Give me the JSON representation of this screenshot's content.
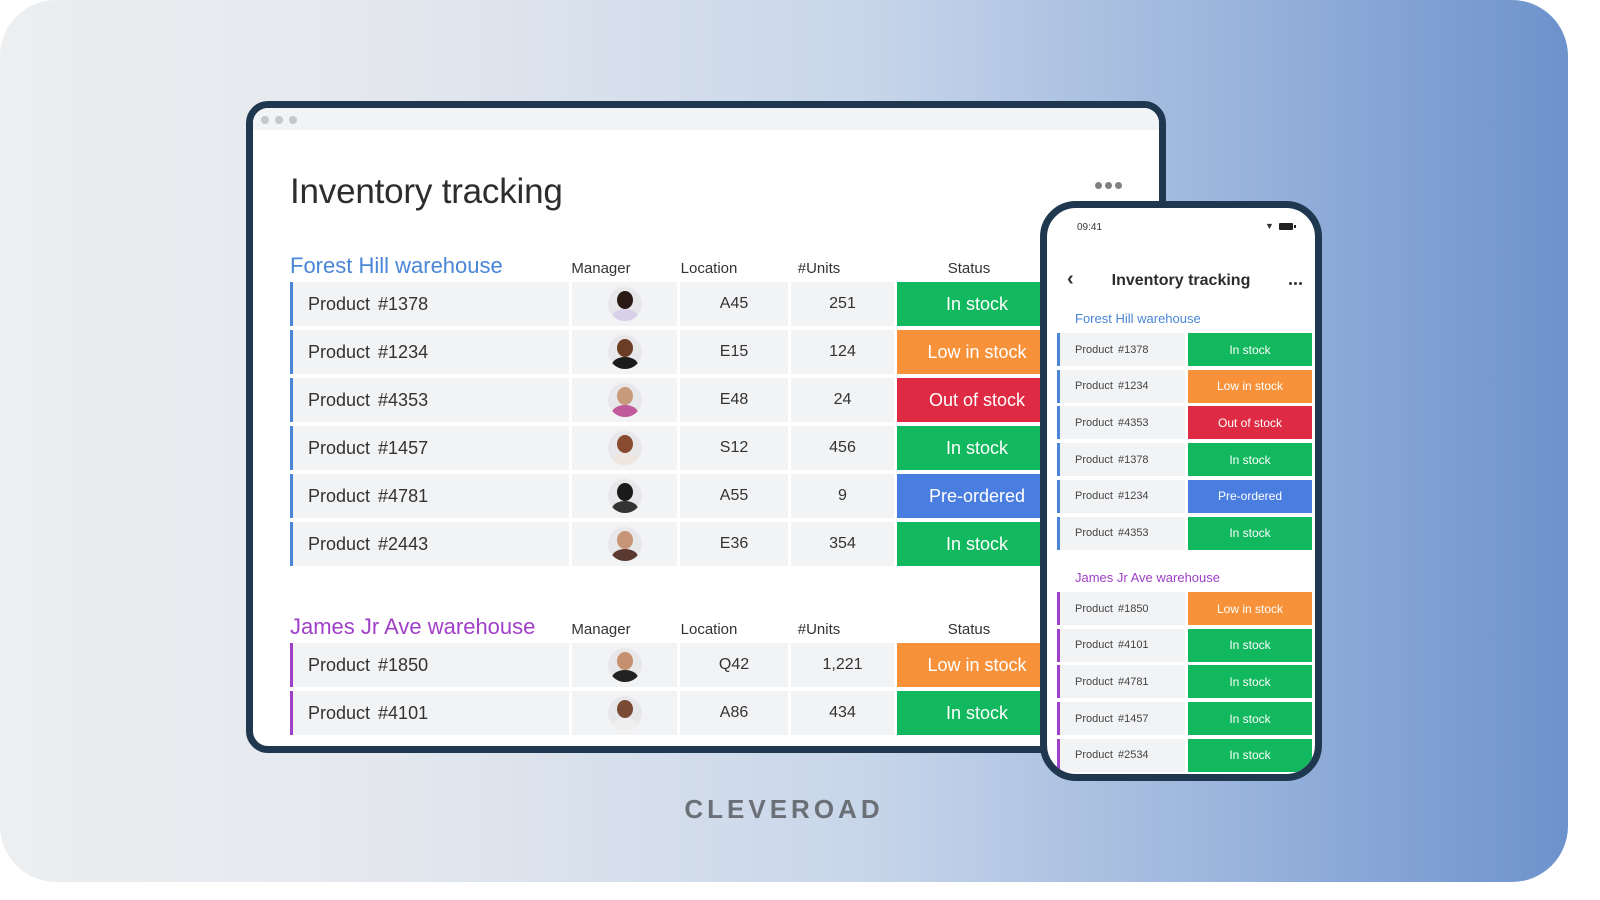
{
  "colors": {
    "in_stock": "#12b85e",
    "low_in_stock": "#f7923a",
    "out_of_stock": "#de2a43",
    "pre_ordered": "#4a7de0",
    "group_blue": "#4a86d8",
    "group_purple": "#a040c8"
  },
  "desktop": {
    "title": "Inventory tracking",
    "more_icon": "more-horizontal-icon",
    "columns": {
      "manager": "Manager",
      "location": "Location",
      "units": "#Units",
      "status": "Status"
    },
    "groups": [
      {
        "name": "Forest Hill warehouse",
        "accent": "blue",
        "rows": [
          {
            "product": "Product  #1378",
            "location": "A45",
            "units": "251",
            "status": "In stock",
            "status_key": "in_stock",
            "avatar": "manager-avatar"
          },
          {
            "product": "Product  #1234",
            "location": "E15",
            "units": "124",
            "status": "Low in stock",
            "status_key": "low_in_stock",
            "avatar": "manager-avatar"
          },
          {
            "product": "Product  #4353",
            "location": "E48",
            "units": "24",
            "status": "Out of stock",
            "status_key": "out_of_stock",
            "avatar": "manager-avatar"
          },
          {
            "product": "Product  #1457",
            "location": "S12",
            "units": "456",
            "status": "In stock",
            "status_key": "in_stock",
            "avatar": "manager-avatar"
          },
          {
            "product": "Product  #4781",
            "location": "A55",
            "units": "9",
            "status": "Pre-ordered",
            "status_key": "pre_ordered",
            "avatar": "manager-avatar"
          },
          {
            "product": "Product  #2443",
            "location": "E36",
            "units": "354",
            "status": "In stock",
            "status_key": "in_stock",
            "avatar": "manager-avatar"
          }
        ]
      },
      {
        "name": "James Jr Ave warehouse",
        "accent": "purple",
        "rows": [
          {
            "product": "Product  #1850",
            "location": "Q42",
            "units": "1,221",
            "status": "Low in stock",
            "status_key": "low_in_stock",
            "avatar": "manager-avatar"
          },
          {
            "product": "Product  #4101",
            "location": "A86",
            "units": "434",
            "status": "In stock",
            "status_key": "in_stock",
            "avatar": "manager-avatar"
          }
        ]
      }
    ]
  },
  "phone": {
    "time": "09:41",
    "back_icon": "chevron-left-icon",
    "title": "Inventory tracking",
    "groups": [
      {
        "name": "Forest Hill warehouse",
        "accent": "blue",
        "rows": [
          {
            "product": "Product #1378",
            "status": "In stock",
            "status_key": "in_stock"
          },
          {
            "product": "Product  #1234",
            "status": "Low in stock",
            "status_key": "low_in_stock"
          },
          {
            "product": "Product  #4353",
            "status": "Out of stock",
            "status_key": "out_of_stock"
          },
          {
            "product": "Product #1378",
            "status": "In stock",
            "status_key": "in_stock"
          },
          {
            "product": "Product  #1234",
            "status": "Pre-ordered",
            "status_key": "pre_ordered"
          },
          {
            "product": "Product  #4353",
            "status": "In stock",
            "status_key": "in_stock"
          }
        ]
      },
      {
        "name": "James Jr Ave warehouse",
        "accent": "purple",
        "rows": [
          {
            "product": "Product  #1850",
            "status": "Low in stock",
            "status_key": "low_in_stock"
          },
          {
            "product": "Product  #4101",
            "status": "In stock",
            "status_key": "in_stock"
          },
          {
            "product": "Product  #4781",
            "status": "In stock",
            "status_key": "in_stock"
          },
          {
            "product": "Product  #1457",
            "status": "In stock",
            "status_key": "in_stock"
          },
          {
            "product": "Product  #2534",
            "status": "In stock",
            "status_key": "in_stock"
          }
        ]
      }
    ]
  },
  "brand": "CLEVEROAD"
}
